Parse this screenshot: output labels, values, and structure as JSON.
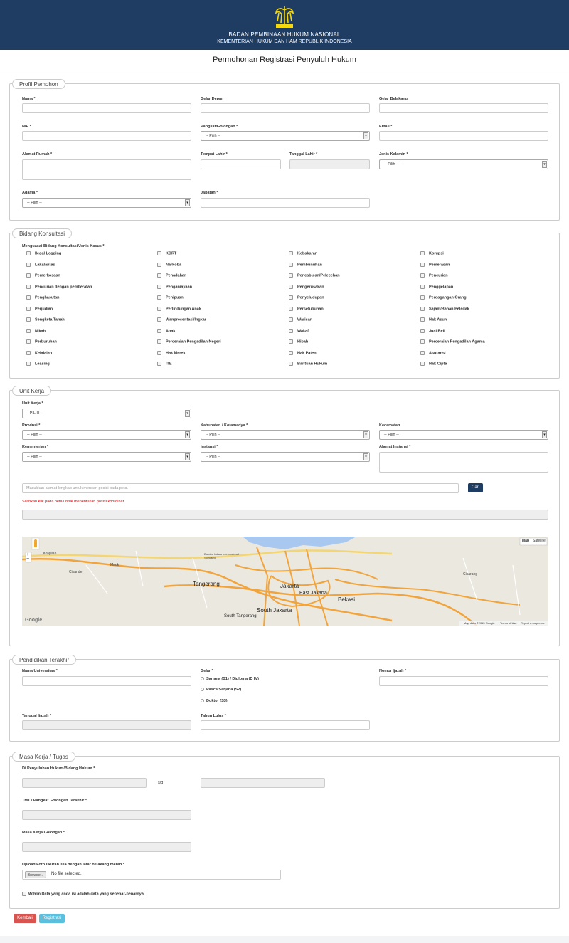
{
  "header": {
    "logo_text": "PENGAYOMAN",
    "line1": "BADAN PEMBINAAN HUKUM NASIONAL",
    "line2": "KEMENTERIAN HUKUM DAN HAM REPUBLIK INDONESIA"
  },
  "page_title": "Permohonan Registrasi Penyuluh Hukum",
  "profil": {
    "legend": "Profil Pemohon",
    "nama": "Nama *",
    "gelar_depan": "Gelar Depan",
    "gelar_belakang": "Gelar Belakang",
    "nip": "NIP *",
    "pangkat": "Pangkat/Golongan *",
    "email": "Email *",
    "alamat": "Alamat Rumah *",
    "tempat_lahir": "Tempat Lahir *",
    "tanggal_lahir": "Tanggal Lahir *",
    "jenis_kelamin": "Jenis Kelamin *",
    "agama": "Agama *",
    "jabatan": "Jabatan *",
    "pilih": "-- Pilih --"
  },
  "bidang": {
    "legend": "Bidang Konsultasi",
    "label": "Menguasai Bidang Konsultasi/Jenis Kasus *",
    "col1": [
      "Ilegal Logging",
      "Lakalantas",
      "Pemerkosaan",
      "Pencurian dengan pemberatan",
      "Penghasutan",
      "Perjudian",
      "Sengketa Tanah",
      "Nikah",
      "Perburuhan",
      "Kelalaian",
      "Leasing"
    ],
    "col2": [
      "KDRT",
      "Narkoba",
      "Penadahan",
      "Penganiayaan",
      "Penipuan",
      "Perlindungan Anak",
      "Wanpresentasi/Ingkar",
      "Anak",
      "Perceraian Pengadilan Negeri",
      "Hak Merek",
      "ITE"
    ],
    "col3": [
      "Kebakaran",
      "Pembunuhan",
      "Pencabulan/Pelecehan",
      "Pengerusakan",
      "Penyeludupan",
      "Persetubuhan",
      "Warisan",
      "Wakaf",
      "Hibah",
      "Hak Paten",
      "Bantuan Hukum"
    ],
    "col4": [
      "Korupsi",
      "Pemerasan",
      "Pencurian",
      "Penggelapan",
      "Perdagangan Orang",
      "Sajam/Bahan Peledak",
      "Hak Asuh",
      "Jual Beli",
      "Perceraian Pengadilan Agama",
      "Asuransi",
      "Hak Cipta"
    ]
  },
  "unit": {
    "legend": "Unit Kerja",
    "unit_kerja": "Unit Kerja *",
    "unit_pilih": "--PILIH--",
    "provinsi": "Provinsi *",
    "kabupaten": "Kabupaten / Kotamadya *",
    "kecamatan": "Kecamatan",
    "kementerian": "Kementerian *",
    "instansi": "Instansi *",
    "alamat_instansi": "Alamat Instansi *",
    "pilih": "-- Pilih --",
    "search_placeholder": "Masukkan alamat lengkap untuk mencari posisi pada peta.",
    "cari": "Cari",
    "hint": "Silahkan klik pada peta untuk menentukan posisi koordinat.",
    "map": {
      "map_btn": "Map",
      "satellite_btn": "Satellite",
      "attribution": "Map data ©2015 Google",
      "terms": "Terms of Use",
      "report": "Report a map error",
      "places": [
        "Jakarta",
        "East Jakarta",
        "South Jakarta",
        "Tangerang",
        "South Tangerang",
        "Bekasi",
        "Kragilan",
        "Cikande",
        "Mauk",
        "Bandar Udara Internasional Soekarno",
        "Cikarang",
        "Google"
      ]
    }
  },
  "pendidikan": {
    "legend": "Pendidikan Terakhir",
    "universitas": "Nama Universitas *",
    "gelar": "Gelar *",
    "nomor_ijazah": "Nomor Ijazah *",
    "gelar_opts": [
      "Sarjana (S1) / Diploma (D IV)",
      "Pasca Sarjana (S2)",
      "Doktor (S3)"
    ],
    "tanggal_ijazah": "Tanggal Ijazah *",
    "tahun_lulus": "Tahun Lulus *"
  },
  "masa": {
    "legend": "Masa Kerja / Tugas",
    "di_penyuluhan": "Di Penyuluhan Hukum/Bidang Hukum *",
    "sd": "s/d",
    "tmt": "TMT / Pangkat Golongan Terakhir *",
    "masa_kerja": "Masa Kerja Golongan *",
    "upload": "Upload Foto ukuran 3x4 dengan latar belakang merah *",
    "browse": "Browse...",
    "no_file": "No file selected.",
    "confirm": "Mohon Data yang anda isi adalah data yang sebenar-benarnya"
  },
  "actions": {
    "kembali": "Kembali",
    "registrasi": "Registrasi"
  },
  "colors": {
    "banner": "#1f3c63",
    "cari": "#1f3c63",
    "kembali": "#d9534f",
    "registrasi": "#5bc0de",
    "hint": "#e00000"
  }
}
